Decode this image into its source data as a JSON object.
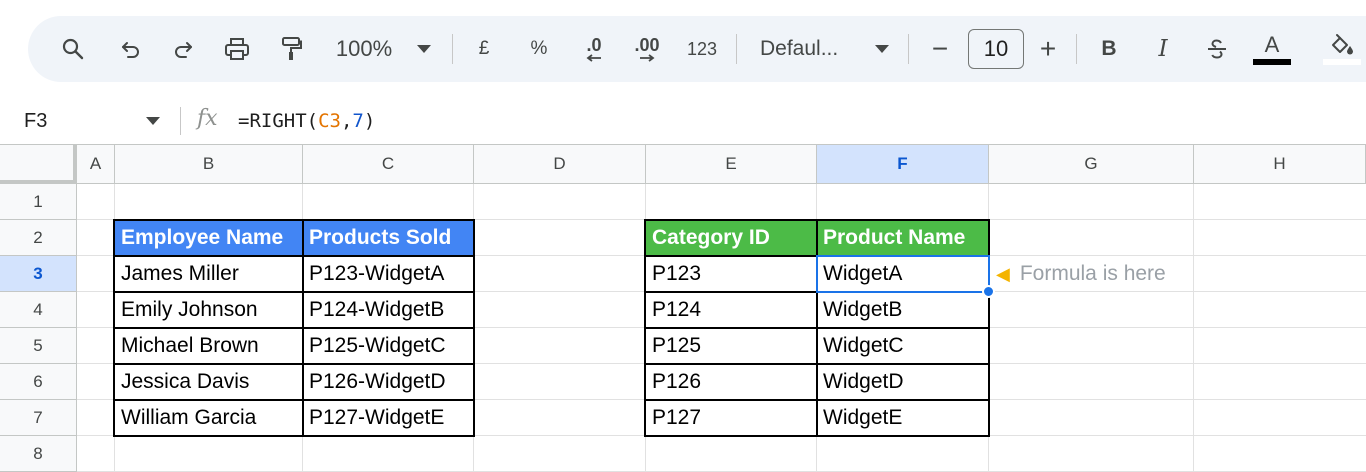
{
  "toolbar": {
    "zoom": "100%",
    "currency": "£",
    "percent": "%",
    "decrease_decimal": ".0",
    "increase_decimal": ".00",
    "number_format": "123",
    "font": "Defaul...",
    "font_size": "10",
    "minus": "−",
    "plus": "+",
    "bold": "B",
    "italic": "I",
    "text_color_letter": "A"
  },
  "formula_bar": {
    "name_box": "F3",
    "fx": "fx",
    "formula_prefix": "=RIGHT(",
    "formula_ref": "C3",
    "formula_comma": ",",
    "formula_num": "7",
    "formula_suffix": ")"
  },
  "columns": [
    "A",
    "B",
    "C",
    "D",
    "E",
    "F",
    "G",
    "H"
  ],
  "rows": [
    "1",
    "2",
    "3",
    "4",
    "5",
    "6",
    "7",
    "8"
  ],
  "selected_column": "F",
  "selected_row": "3",
  "table_left": {
    "headers": [
      "Employee Name",
      "Products Sold"
    ],
    "rows": [
      [
        "James Miller",
        "P123-WidgetA"
      ],
      [
        "Emily Johnson",
        "P124-WidgetB"
      ],
      [
        "Michael Brown",
        "P125-WidgetC"
      ],
      [
        "Jessica Davis",
        "P126-WidgetD"
      ],
      [
        "William Garcia",
        "P127-WidgetE"
      ]
    ]
  },
  "table_right": {
    "headers": [
      "Category ID",
      "Product Name"
    ],
    "rows": [
      [
        "P123",
        "WidgetA"
      ],
      [
        "P124",
        "WidgetB"
      ],
      [
        "P125",
        "WidgetC"
      ],
      [
        "P126",
        "WidgetD"
      ],
      [
        "P127",
        "WidgetE"
      ]
    ]
  },
  "note": {
    "icon": "pointing-hand-icon",
    "text": "Formula is here"
  },
  "colors": {
    "header_blue": "#4285f4",
    "header_green": "#4cbb47",
    "selection": "#1a73e8"
  }
}
